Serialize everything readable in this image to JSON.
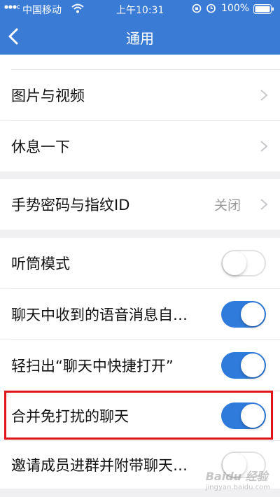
{
  "status_bar": {
    "carrier": "中国移动",
    "time": "上午10:31",
    "battery": "100%",
    "icons": [
      "signal-icon",
      "wifi-icon",
      "lock-rotation-icon",
      "alarm-icon",
      "battery-icon"
    ]
  },
  "nav": {
    "title": "通用",
    "back_icon": "chevron-left-icon"
  },
  "groups": [
    {
      "items": [
        {
          "label": "图片与视频",
          "type": "link"
        },
        {
          "label": "休息一下",
          "type": "link"
        }
      ]
    },
    {
      "items": [
        {
          "label": "手势密码与指纹ID",
          "type": "link",
          "value": "关闭"
        }
      ]
    },
    {
      "items": [
        {
          "label": "听筒模式",
          "type": "toggle",
          "on": false
        },
        {
          "label": "聊天中收到的语音消息自…",
          "type": "toggle",
          "on": true
        },
        {
          "label": "轻扫出“聊天中快捷打开”",
          "type": "toggle",
          "on": true
        },
        {
          "label": "合并免打扰的聊天",
          "type": "toggle",
          "on": true,
          "highlighted": true
        },
        {
          "label": "邀请成员进群并附带聊天…",
          "type": "toggle",
          "on": false
        }
      ]
    }
  ],
  "watermark": {
    "text": "Baidu 经验",
    "sub": "jingyan.baidu.com"
  },
  "colors": {
    "header": "#3a7bd5",
    "toggle_on": "#2f7bdc",
    "highlight_box": "#e0161c"
  }
}
